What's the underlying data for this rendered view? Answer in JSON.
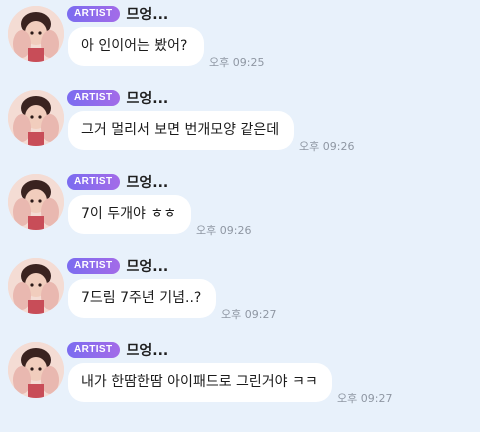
{
  "messages": [
    {
      "badge": "ARTIST",
      "sender": "므엉...",
      "text": "아 인이어는 봤어?",
      "time": "오후 09:25"
    },
    {
      "badge": "ARTIST",
      "sender": "므엉...",
      "text": "그거 멀리서 보면 번개모양 같은데",
      "time": "오후 09:26"
    },
    {
      "badge": "ARTIST",
      "sender": "므엉...",
      "text": "7이 두개야 ㅎㅎ",
      "time": "오후 09:26"
    },
    {
      "badge": "ARTIST",
      "sender": "므엉...",
      "text": "7드림 7주년 기념..?",
      "time": "오후 09:27"
    },
    {
      "badge": "ARTIST",
      "sender": "므엉...",
      "text": "내가 한땀한땀 아이패드로 그린거야 ㅋㅋ",
      "time": "오후 09:27"
    }
  ]
}
